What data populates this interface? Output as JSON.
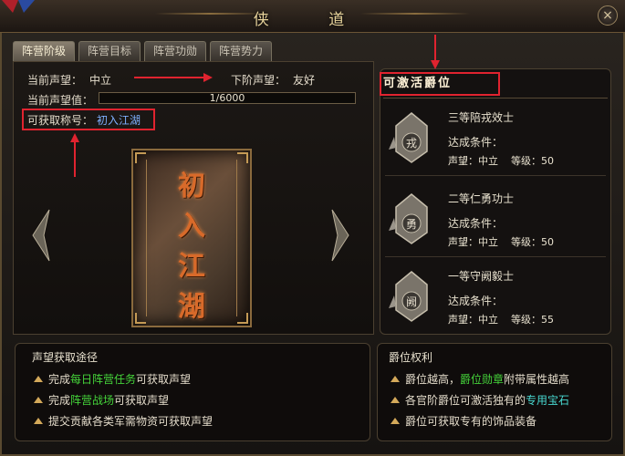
{
  "window": {
    "title": "侠 道",
    "close_icon": "×"
  },
  "tabs": [
    {
      "label": "阵营阶级",
      "active": true
    },
    {
      "label": "阵营目标",
      "active": false
    },
    {
      "label": "阵营功勋",
      "active": false
    },
    {
      "label": "阵营势力",
      "active": false
    }
  ],
  "status": {
    "current_rep_label": "当前声望：",
    "current_rep_value": "中立",
    "next_rep_label": "下阶声望：",
    "next_rep_value": "友好",
    "rep_value_label": "当前声望值：",
    "rep_progress_text": "1/6000",
    "rep_progress": 0.000167,
    "title_label": "可获取称号：",
    "title_value": "初入江湖"
  },
  "scroll": {
    "chars": [
      "初",
      "入",
      "江",
      "湖"
    ]
  },
  "ranks": {
    "header": "可激活爵位",
    "items": [
      {
        "name": "三等陪戎效士",
        "seal_char": "戎",
        "cond_title": "达成条件：",
        "cond_rep": "声望：中立",
        "cond_level": "等级：50"
      },
      {
        "name": "二等仁勇功士",
        "seal_char": "勇",
        "cond_title": "达成条件：",
        "cond_rep": "声望：中立",
        "cond_level": "等级：50"
      },
      {
        "name": "一等守阙毅士",
        "seal_char": "阙",
        "cond_title": "达成条件：",
        "cond_rep": "声望：中立",
        "cond_level": "等级：55"
      }
    ]
  },
  "rep_sources": {
    "title": "声望获取途径",
    "lines": [
      {
        "pre": "完成",
        "hl": "每日阵营任务",
        "post": "可获取声望"
      },
      {
        "pre": "完成",
        "hl": "阵营战场",
        "post": "可获取声望"
      },
      {
        "pre": "提交贡献各类军需物资可获取声望",
        "hl": "",
        "post": ""
      }
    ]
  },
  "rank_rights": {
    "title": "爵位权利",
    "lines": [
      {
        "pre": "爵位越高，",
        "hl": "爵位勋章",
        "post": "附带属性越高",
        "hl_class": "hl-green"
      },
      {
        "pre": "各官阶爵位可激活独有的",
        "hl": "专用宝石",
        "post": "",
        "hl_class": "hl-cyan"
      },
      {
        "pre": "爵位可获取专有的饰品装备",
        "hl": "",
        "post": "",
        "hl_class": ""
      }
    ]
  },
  "colors": {
    "annotation_red": "#e0232f",
    "gold": "#d4a95a",
    "highlight_green": "#45d43a",
    "highlight_cyan": "#48d8d0",
    "title_blue": "#7fb0ff"
  }
}
